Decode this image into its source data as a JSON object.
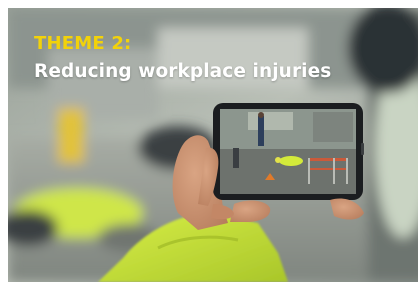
{
  "card": {
    "theme_label": "THEME 2:",
    "theme_title": "Reducing workplace injuries"
  },
  "image": {
    "subject": "worker-filming-scene-on-phone-photo"
  },
  "colors": {
    "label_accent": "#f2d20a",
    "title_text": "#ffffff",
    "hi_vis_jacket": "#c8e23a"
  }
}
